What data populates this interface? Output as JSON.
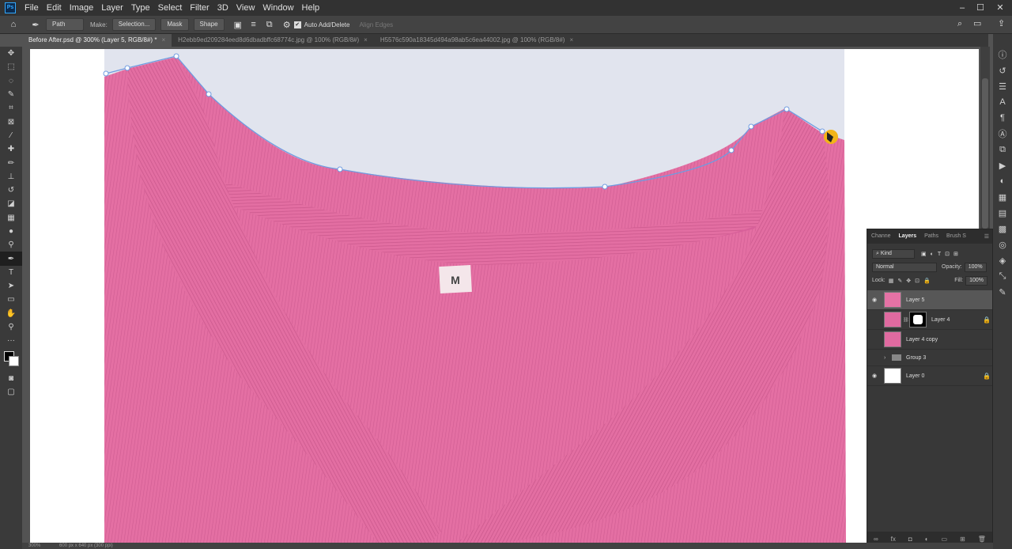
{
  "menubar": {
    "app_badge": "Ps",
    "items": [
      "File",
      "Edit",
      "Image",
      "Layer",
      "Type",
      "Select",
      "Filter",
      "3D",
      "View",
      "Window",
      "Help"
    ],
    "window_controls": {
      "minimize": "–",
      "maximize": "☐",
      "close": "✕"
    }
  },
  "options": {
    "mode": "Path",
    "make_label": "Make:",
    "selection": "Selection...",
    "mask": "Mask",
    "shape": "Shape",
    "auto_add_delete": "Auto Add/Delete",
    "align_edges": "Align Edges"
  },
  "tabs": [
    {
      "label": "Before After.psd @ 300% (Layer 5, RGB/8#) *"
    },
    {
      "label": "H2ebb9ed209284eed8d6dbadbffc68774c.jpg @ 100% (RGB/8#)"
    },
    {
      "label": "H5576c590a18345d494a98ab5c6ea44002.jpg @ 100% (RGB/8#)"
    }
  ],
  "document": {
    "tag_letter": "M"
  },
  "layers_panel": {
    "tabs": [
      "Channe",
      "Layers",
      "Paths",
      "Brush S"
    ],
    "kind_label": "Kind",
    "blend_mode": "Normal",
    "opacity_label": "Opacity:",
    "opacity_value": "100%",
    "lock_label": "Lock:",
    "fill_label": "Fill:",
    "fill_value": "100%",
    "layers": [
      {
        "name": "Layer 5",
        "visible": true,
        "selected": true,
        "locked": false
      },
      {
        "name": "Layer 4",
        "visible": false,
        "selected": false,
        "locked": true
      },
      {
        "name": "Layer 4 copy",
        "visible": false,
        "selected": false,
        "locked": false
      },
      {
        "name": "Group 3",
        "visible": false,
        "selected": false,
        "locked": false
      },
      {
        "name": "Layer 0",
        "visible": true,
        "selected": false,
        "locked": true
      }
    ]
  },
  "status": {
    "zoom": "300%",
    "doc_size": "600 px x 640 px (300 ppi)"
  },
  "colors": {
    "shirt": "#e572a5",
    "backdrop": "#e1e4ee",
    "path": "#6f9be0",
    "cursor": "#f2b418"
  }
}
